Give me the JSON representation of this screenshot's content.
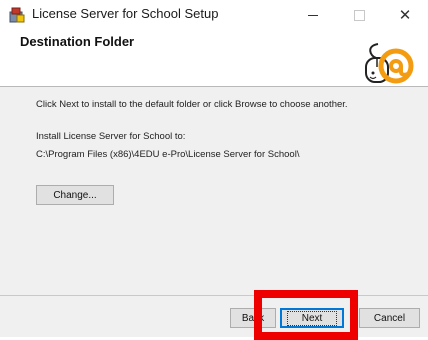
{
  "window": {
    "title": "License Server for School Setup",
    "icon": "setup-app-icon"
  },
  "header": {
    "title": "Destination Folder",
    "logo_icon": "at-mouse-logo-icon"
  },
  "main": {
    "instruction": "Click Next to install to the default folder or click Browse to choose another.",
    "install_label": "Install License Server for School to:",
    "install_path": "C:\\Program Files (x86)\\4EDU e-Pro\\License Server for School\\",
    "change_button": "Change..."
  },
  "footer": {
    "back_button": "Back",
    "next_button": "Next",
    "cancel_button": "Cancel"
  },
  "annotation": {
    "highlight_color": "#ee0000",
    "target": "next-button"
  }
}
